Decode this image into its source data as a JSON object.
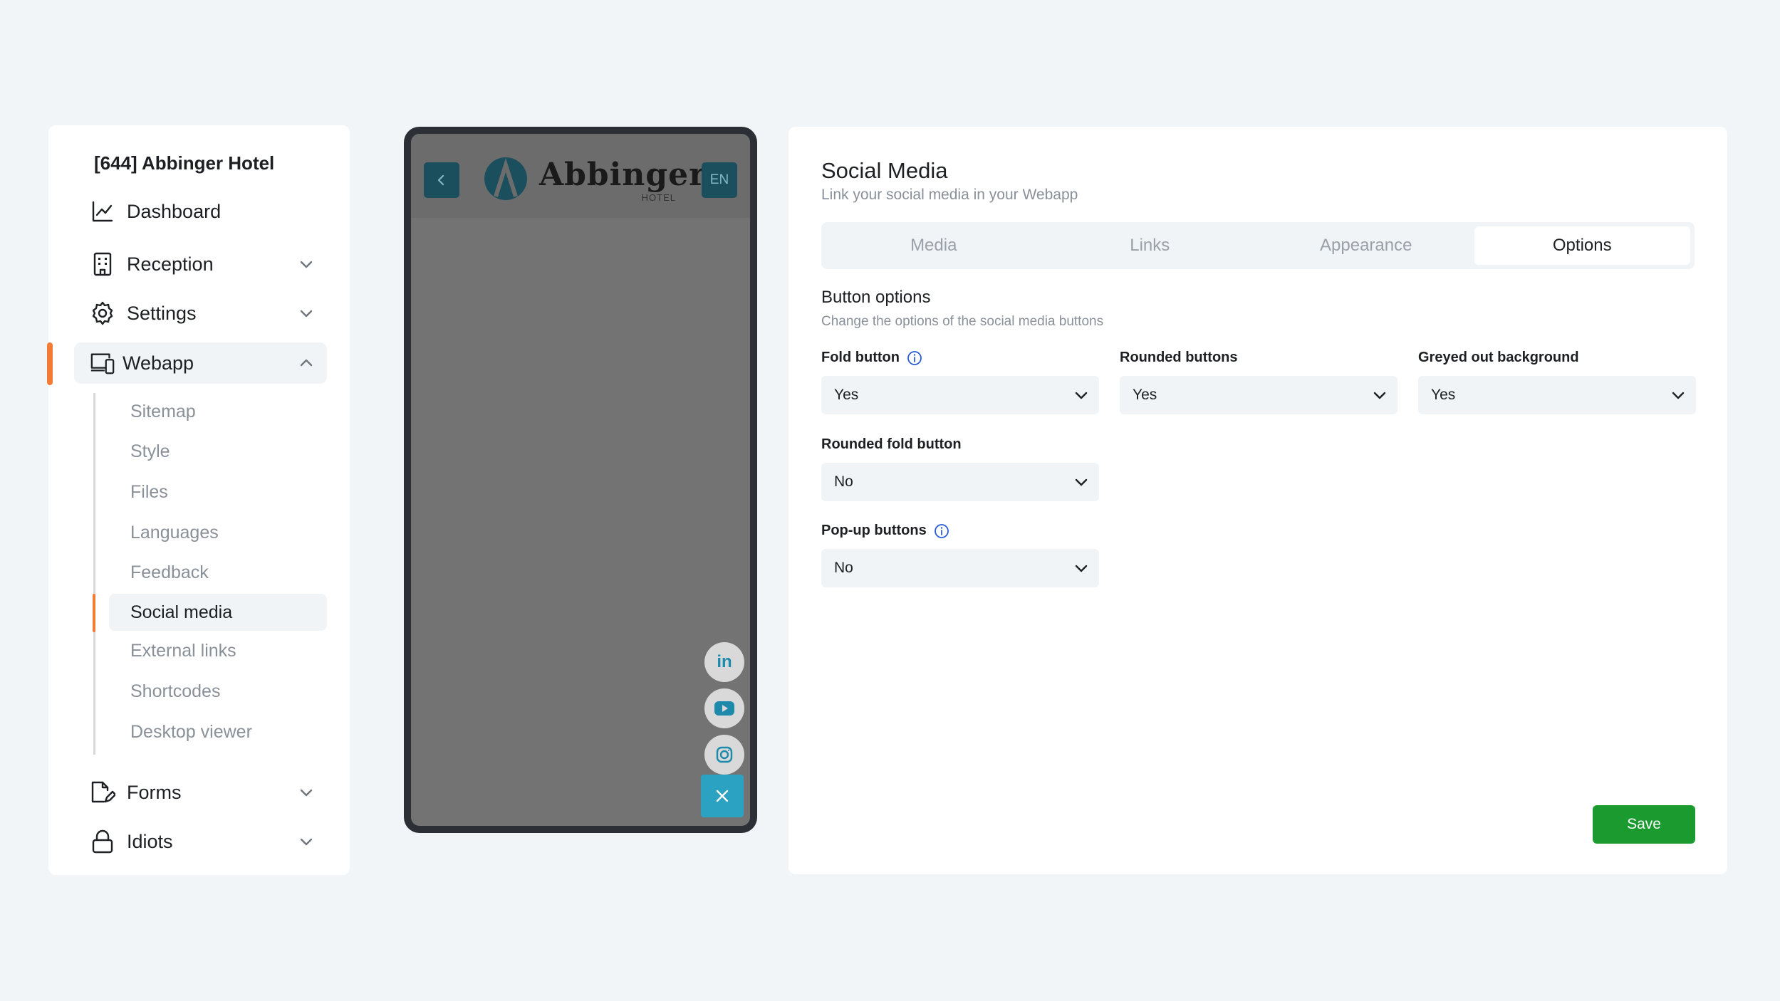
{
  "sidebar": {
    "hotel_name": "[644] Abbinger Hotel",
    "items": [
      {
        "label": "Dashboard",
        "icon": "chart-line-icon",
        "expandable": false
      },
      {
        "label": "Reception",
        "icon": "building-icon",
        "expandable": true
      },
      {
        "label": "Settings",
        "icon": "gear-icon",
        "expandable": true
      },
      {
        "label": "Webapp",
        "icon": "devices-icon",
        "expandable": true,
        "expanded": true
      },
      {
        "label": "Forms",
        "icon": "document-edit-icon",
        "expandable": true
      },
      {
        "label": "Idiots",
        "icon": "lock-icon",
        "expandable": true
      }
    ],
    "webapp_sub": [
      "Sitemap",
      "Style",
      "Files",
      "Languages",
      "Feedback",
      "Social media",
      "External links",
      "Shortcodes",
      "Desktop viewer"
    ],
    "active_sub": "Social media",
    "accent_color": "#f47b35"
  },
  "preview": {
    "logo_name": "Abbinger",
    "logo_sub": "HOTEL",
    "language": "EN",
    "social_icons": [
      "linkedin-icon",
      "youtube-icon",
      "instagram-icon"
    ],
    "linkedin_text": "in",
    "brand_color": "#1c4f5e",
    "fold_button_color": "#2ba2c2"
  },
  "panel": {
    "title": "Social Media",
    "subtitle": "Link your social media in your Webapp",
    "tabs": [
      "Media",
      "Links",
      "Appearance",
      "Options"
    ],
    "active_tab": "Options",
    "section_title": "Button options",
    "section_subtitle": "Change the options of the social media buttons",
    "fields": {
      "fold_button": {
        "label": "Fold button",
        "value": "Yes"
      },
      "rounded_buttons": {
        "label": "Rounded buttons",
        "value": "Yes"
      },
      "greyed_out_background": {
        "label": "Greyed out background",
        "value": "Yes"
      },
      "rounded_fold_button": {
        "label": "Rounded fold button",
        "value": "No"
      },
      "popup_buttons": {
        "label": "Pop-up buttons",
        "value": "No"
      }
    },
    "save_label": "Save",
    "save_color": "#1a9a2f"
  }
}
